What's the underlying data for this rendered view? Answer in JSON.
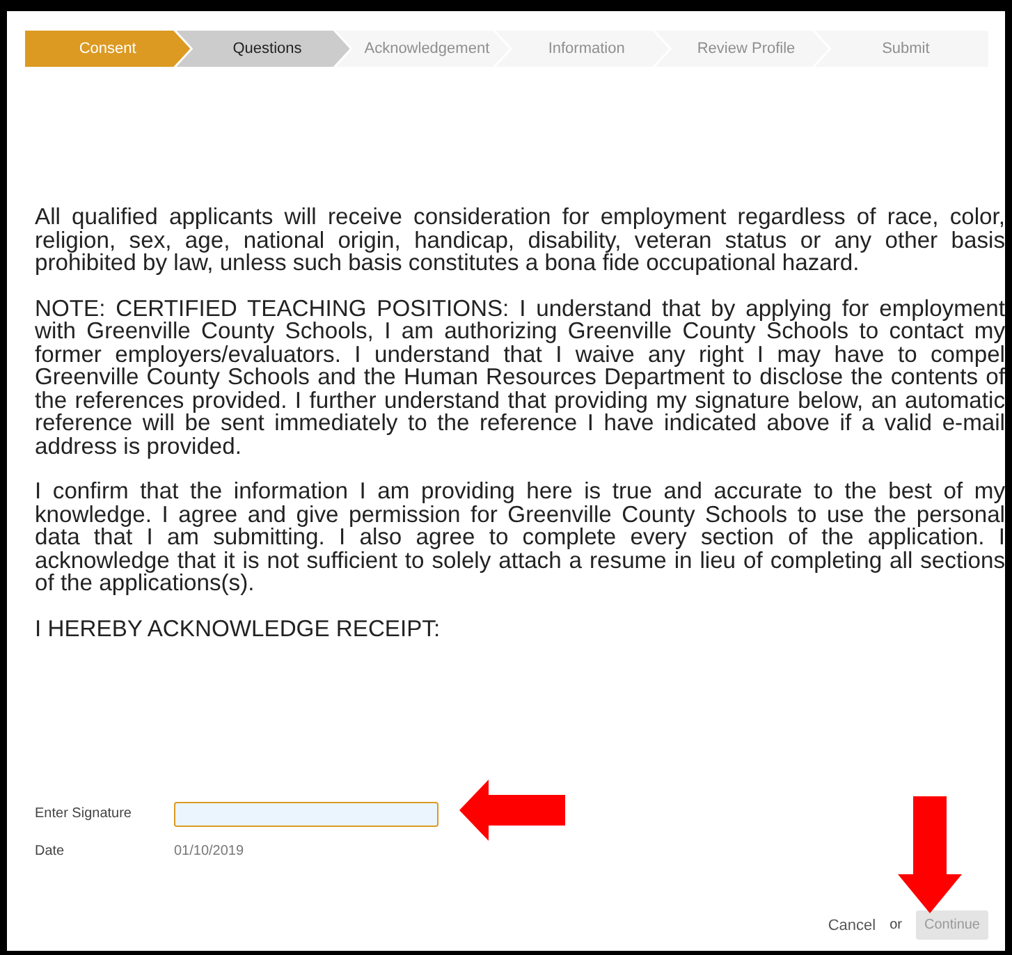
{
  "steps": [
    {
      "label": "Consent",
      "selected": true,
      "disabled": false
    },
    {
      "label": "Questions",
      "selected": false,
      "disabled": false
    },
    {
      "label": "Acknowledgement",
      "selected": false,
      "disabled": true
    },
    {
      "label": "Information",
      "selected": false,
      "disabled": true
    },
    {
      "label": "Review Profile",
      "selected": false,
      "disabled": true
    },
    {
      "label": "Submit",
      "selected": false,
      "disabled": true
    }
  ],
  "paragraphs": [
    "All qualified applicants will receive consideration for employment regardless of race, color, religion, sex, age, national origin, handicap, disability, veteran status or any other basis prohibited by law, unless such basis constitutes a bona fide occupational hazard.",
    "NOTE: CERTIFIED TEACHING POSITIONS: I understand that by applying for employment with Greenville County Schools, I am authorizing Greenville County Schools to contact my former employers/evaluators. I understand that I waive any right I may have to compel Greenville County Schools and the Human Resources Department to disclose the contents of the references provided.  I further understand that providing my signature below, an automatic reference will be sent immediately to the reference I have indicated above if a valid e-mail address is provided.",
    "I confirm that the information I am providing here is true and accurate to the best of my knowledge.  I agree and give permission for Greenville County Schools to use the personal data that I am submitting.  I also agree to complete every section of the application.  I acknowledge that it is not sufficient to solely attach a resume in lieu of completing all sections of the applications(s).",
    "I HEREBY ACKNOWLEDGE RECEIPT:"
  ],
  "signature": {
    "label": "Enter Signature",
    "focused": true
  },
  "date": {
    "label": "Date",
    "value": "01/10/2019"
  },
  "footer": {
    "cancel": "Cancel",
    "or": "or",
    "continue": {
      "label": "Continue",
      "disabled": true
    }
  }
}
